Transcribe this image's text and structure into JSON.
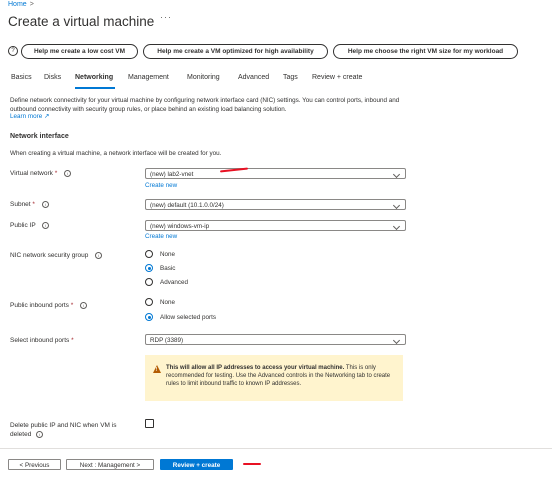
{
  "breadcrumb": {
    "home": "Home",
    "separator": ">"
  },
  "page": {
    "title": "Create a virtual machine",
    "more": "···"
  },
  "help_buttons": [
    "Help me create a low cost VM",
    "Help me create a VM optimized for high availability",
    "Help me choose the right VM size for my workload"
  ],
  "tabs": [
    "Basics",
    "Disks",
    "Networking",
    "Management",
    "Monitoring",
    "Advanced",
    "Tags",
    "Review + create"
  ],
  "active_tab": "Networking",
  "description": "Define network connectivity for your virtual machine by configuring network interface card (NIC) settings. You can control ports, inbound and outbound connectivity with security group rules, or place behind an existing load balancing solution.",
  "learn_more": "Learn more ↗",
  "network_interface": {
    "heading": "Network interface",
    "description": "When creating a virtual machine, a network interface will be created for you."
  },
  "fields": {
    "virtual_network": {
      "label": "Virtual network",
      "required": "*",
      "value": "(new) lab2-vnet",
      "create_new": "Create new"
    },
    "subnet": {
      "label": "Subnet",
      "required": "*",
      "value": "(new) default (10.1.0.0/24)"
    },
    "public_ip": {
      "label": "Public IP",
      "value": "(new) windows-vm-ip",
      "create_new": "Create new"
    },
    "nsg": {
      "label": "NIC network security group",
      "options": [
        "None",
        "Basic",
        "Advanced"
      ],
      "selected": "Basic"
    },
    "inbound_ports": {
      "label": "Public inbound ports",
      "required": "*",
      "options": [
        "None",
        "Allow selected ports"
      ],
      "selected": "Allow selected ports"
    },
    "select_ports": {
      "label": "Select inbound ports",
      "required": "*",
      "value": "RDP (3389)"
    },
    "delete_ip": {
      "label_line1": "Delete public IP and NIC when VM is",
      "label_line2": "deleted",
      "checked": false
    }
  },
  "warning": {
    "bold": "This will allow all IP addresses to access your virtual machine.",
    "text": " This is only recommended for testing.  Use the Advanced controls in the Networking tab to create rules to limit inbound traffic to known IP addresses."
  },
  "footer": {
    "previous": "< Previous",
    "next": "Next : Management >",
    "review": "Review + create"
  },
  "colors": {
    "accent": "#0078d4",
    "annotation": "#e81123",
    "warning_bg": "#fff4ce"
  }
}
